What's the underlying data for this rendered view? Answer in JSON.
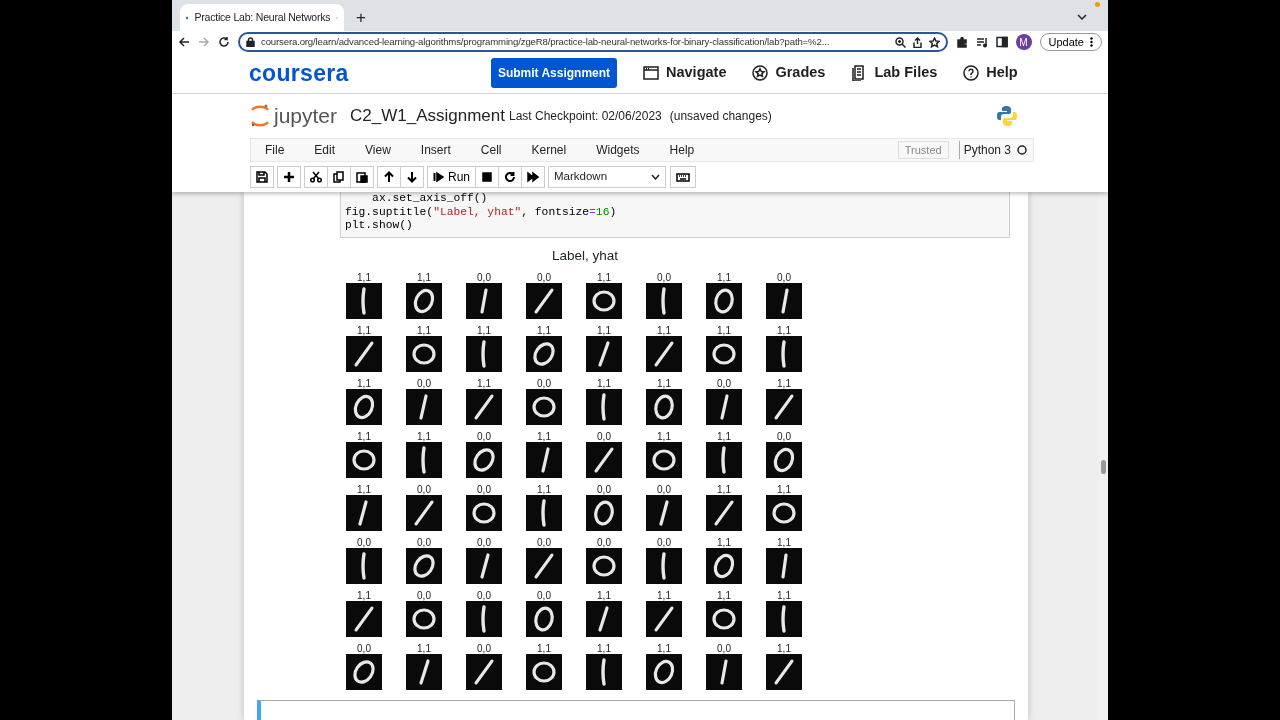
{
  "browser": {
    "tab_title": "Practice Lab: Neural Networks",
    "new_tab": "+",
    "url": "coursera.org/learn/advanced-learning-algorithms/programming/zgeR8/practice-lab-neural-networks-for-binary-classification/lab?path=%2...",
    "avatar": "M",
    "update_button": "Update"
  },
  "site_header": {
    "logo": "coursera",
    "submit_button": "Submit Assignment",
    "nav": [
      {
        "label": "Navigate",
        "kind": "window"
      },
      {
        "label": "Grades",
        "kind": "star"
      },
      {
        "label": "Lab Files",
        "kind": "files"
      },
      {
        "label": "Help",
        "kind": "help"
      }
    ]
  },
  "notebook_header": {
    "logo": "jupyter",
    "name": "C2_W1_Assignment",
    "checkpoint": "Last Checkpoint: 02/06/2023",
    "status": "(unsaved changes)"
  },
  "menu": [
    "File",
    "Edit",
    "View",
    "Insert",
    "Cell",
    "Kernel",
    "Widgets",
    "Help"
  ],
  "trusted": "Trusted",
  "kernel": "Python 3",
  "toolbar": [
    {
      "kind": "save"
    },
    {
      "kind": "add"
    },
    {
      "kind": "cut"
    },
    {
      "kind": "copy"
    },
    {
      "kind": "paste"
    },
    {
      "kind": "up"
    },
    {
      "kind": "down"
    },
    {
      "kind": "run",
      "label": "Run"
    },
    {
      "kind": "stop"
    },
    {
      "kind": "restart"
    },
    {
      "kind": "forward"
    },
    {
      "kind": "select",
      "label": "Markdown"
    },
    {
      "kind": "keyboard"
    }
  ],
  "code_lines": [
    [
      {
        "text": "    ax.set_axis_off()",
        "kind": "plain"
      }
    ],
    [
      {
        "text": "fig.suptitle(",
        "kind": "plain"
      },
      {
        "text": "\"Label, yhat\"",
        "kind": "string"
      },
      {
        "text": ", fontsize",
        "kind": "plain"
      },
      {
        "text": "=",
        "kind": "operator"
      },
      {
        "text": "16",
        "kind": "number"
      },
      {
        "text": ")",
        "kind": "plain"
      }
    ],
    [
      {
        "text": "plt.show()",
        "kind": "plain"
      }
    ]
  ],
  "figure": {
    "title": "Label, yhat",
    "subplots": [
      {
        "label": "1,1"
      },
      {
        "label": "1,1"
      },
      {
        "label": "0,0"
      },
      {
        "label": "0,0"
      },
      {
        "label": "1,1"
      },
      {
        "label": "0,0"
      },
      {
        "label": "1,1"
      },
      {
        "label": "0,0"
      },
      {
        "label": "1,1"
      },
      {
        "label": "1,1"
      },
      {
        "label": "1,1"
      },
      {
        "label": "1,1"
      },
      {
        "label": "1,1"
      },
      {
        "label": "1,1"
      },
      {
        "label": "1,1"
      },
      {
        "label": "1,1"
      },
      {
        "label": "1,1"
      },
      {
        "label": "0,0"
      },
      {
        "label": "1,1"
      },
      {
        "label": "0,0"
      },
      {
        "label": "1,1"
      },
      {
        "label": "1,1"
      },
      {
        "label": "0,0"
      },
      {
        "label": "1,1"
      },
      {
        "label": "1,1"
      },
      {
        "label": "1,1"
      },
      {
        "label": "0,0"
      },
      {
        "label": "1,1"
      },
      {
        "label": "0,0"
      },
      {
        "label": "1,1"
      },
      {
        "label": "1,1"
      },
      {
        "label": "0,0"
      },
      {
        "label": "1,1"
      },
      {
        "label": "0,0"
      },
      {
        "label": "0,0"
      },
      {
        "label": "1,1"
      },
      {
        "label": "0,0"
      },
      {
        "label": "0,0"
      },
      {
        "label": "1,1"
      },
      {
        "label": "1,1"
      },
      {
        "label": "0,0"
      },
      {
        "label": "0,0"
      },
      {
        "label": "0,0"
      },
      {
        "label": "0,0"
      },
      {
        "label": "0,0"
      },
      {
        "label": "0,0"
      },
      {
        "label": "1,1"
      },
      {
        "label": "1,1"
      },
      {
        "label": "1,1"
      },
      {
        "label": "0,0"
      },
      {
        "label": "0,0"
      },
      {
        "label": "0,0"
      },
      {
        "label": "1,1"
      },
      {
        "label": "1,1"
      },
      {
        "label": "1,1"
      },
      {
        "label": "1,1"
      },
      {
        "label": "0,0"
      },
      {
        "label": "1,1"
      },
      {
        "label": "0,0"
      },
      {
        "label": "1,1"
      },
      {
        "label": "1,1"
      },
      {
        "label": "1,1"
      },
      {
        "label": "0,0"
      },
      {
        "label": "1,1"
      }
    ]
  }
}
